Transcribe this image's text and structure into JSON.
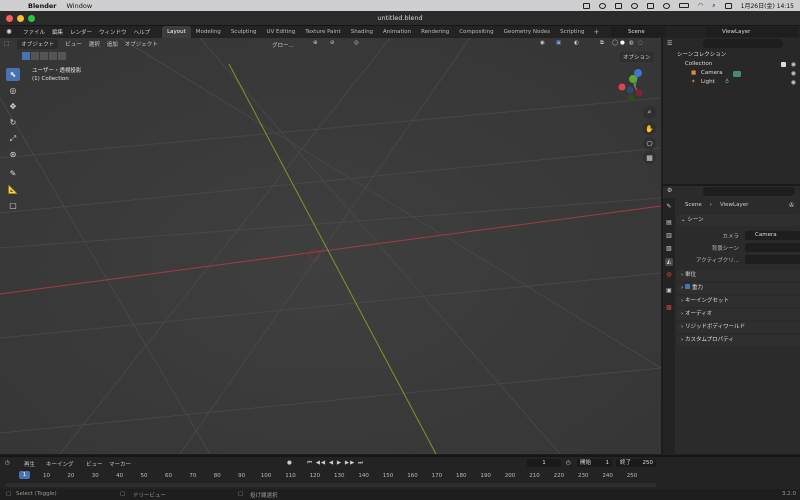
{
  "macos_menubar": {
    "app": "Blender",
    "menus": [
      "Window"
    ],
    "clock": "1月26日(金)  14:15"
  },
  "window": {
    "title": "untitled.blend",
    "traffic_colors": [
      "#ff5f57",
      "#febc2e",
      "#28c840"
    ]
  },
  "topbar": {
    "menus": [
      "ファイル",
      "編集",
      "レンダー",
      "ウィンドウ",
      "ヘルプ"
    ],
    "workspace_tabs": [
      {
        "label": "Layout",
        "active": true
      },
      {
        "label": "Modeling",
        "active": false
      },
      {
        "label": "Sculpting",
        "active": false
      },
      {
        "label": "UV Editing",
        "active": false
      },
      {
        "label": "Texture Paint",
        "active": false
      },
      {
        "label": "Shading",
        "active": false
      },
      {
        "label": "Animation",
        "active": false
      },
      {
        "label": "Rendering",
        "active": false
      },
      {
        "label": "Compositing",
        "active": false
      },
      {
        "label": "Geometry Nodes",
        "active": false
      },
      {
        "label": "Scripting",
        "active": false
      }
    ],
    "add_tab": "+",
    "scene": "Scene",
    "view_layer": "ViewLayer"
  },
  "viewport": {
    "mode": "オブジェクト",
    "menus": [
      "ビュー",
      "選択",
      "追加",
      "オブジェクト"
    ],
    "transform_orientation": "グロー...",
    "view_name": "ユーザー・透視投影",
    "collection_info": "(1) Collection",
    "options": "オプション",
    "colors": {
      "x_axis": "#a63a45",
      "y_axis": "#7a9a22",
      "gizmo_x": "#e0424f",
      "gizmo_y": "#5ca82a",
      "gizmo_z": "#3b76d6"
    }
  },
  "outliner": {
    "root": "シーンコレクション",
    "items": [
      {
        "label": "Collection",
        "level": 1
      },
      {
        "label": "Camera",
        "level": 2
      },
      {
        "label": "Light",
        "level": 2
      }
    ]
  },
  "properties": {
    "breadcrumb": [
      "Scene",
      "ViewLayer"
    ],
    "scene_panel": "シーン",
    "fields": [
      {
        "label": "カメラ",
        "value": "Camera"
      },
      {
        "label": "背景シーン",
        "value": ""
      },
      {
        "label": "アクティブクリ...",
        "value": ""
      }
    ],
    "panels": [
      "単位",
      "重力",
      "キーイングセット",
      "オーディオ",
      "リジッドボディワールド",
      "カスタムプロパティ"
    ]
  },
  "timeline": {
    "menus": [
      "再生",
      "キーイング",
      "ビュー",
      "マーカー"
    ],
    "current_frame": "1",
    "current_frame_field": "1",
    "start_label": "開始",
    "start": "1",
    "end_label": "終了",
    "end": "250",
    "ticks": [
      "1",
      "10",
      "20",
      "30",
      "40",
      "50",
      "60",
      "70",
      "80",
      "90",
      "100",
      "110",
      "120",
      "130",
      "140",
      "150",
      "160",
      "170",
      "180",
      "190",
      "200",
      "210",
      "220",
      "230",
      "240",
      "250"
    ]
  },
  "statusbar": {
    "left": "Select (Toggle)",
    "middle": "ドリービュー",
    "right": "投げ縄選択",
    "version": "3.2.0"
  }
}
